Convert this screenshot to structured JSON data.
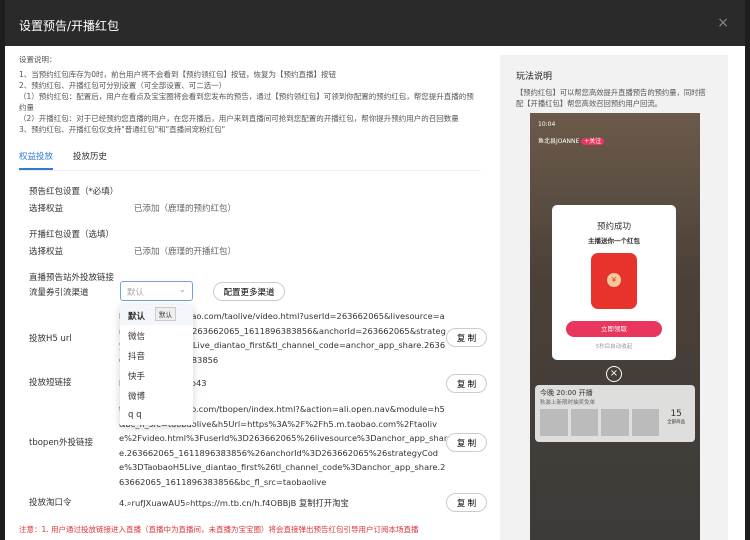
{
  "modal": {
    "title": "设置预告/开播红包",
    "close": "×"
  },
  "notes": {
    "title": "设置说明：",
    "lines": [
      "1、当预约红包库存为0时，前台用户将不会看到【预约领红包】按钮，恢复为【预约直播】按钮",
      "2、预约红包、开播红包可分别设置（可全部设置、可二选一）",
      "（1）预约红包：配置后，用户在看点及宝宝圈将会看到您发布的预告，通过【预约领红包】可领到你配置的预约红包，帮您提升直播的预约量",
      "（2）开播红包：对于已经预约您直播的用户，在您开播后，用户来到直播间可抢到您配置的开播红包，帮你提升预约用户的召回数量",
      "3、预约红包、开播红包仅支持\"普通红包\"和\"直播间宠粉红包\""
    ]
  },
  "tabs": [
    {
      "label": "权益投放",
      "active": true
    },
    {
      "label": "投放历史",
      "active": false
    }
  ],
  "preview_section": {
    "title": "预告红包设置（*必填）",
    "label": "选择权益",
    "value": "已添加（鹿瑾的预约红包）"
  },
  "live_section": {
    "title": "开播红包设置（选填）",
    "label": "选择权益",
    "value": "已添加（鹿瑾的开播红包）"
  },
  "links": {
    "title": "直播预告站外投放链接",
    "channel_label": "流量券引流渠道",
    "channel_placeholder": "默认",
    "more_channels": "配置更多渠道",
    "options": [
      "默认",
      "微信",
      "抖音",
      "快手",
      "微博",
      "q q"
    ],
    "tooltip": "默认",
    "rows": [
      {
        "label": "投放H5 url",
        "value": "https://h5.m.taobao.com/taolive/video.html?userId=263662065&livesource=anchor_app_share.263662065_1611896383856&anchorId=263662065&strategyCode=TaobaoH5Live_diantao_first&tl_channel_code=anchor_app_share.263662065_1611896383856",
        "copy": "复 制"
      },
      {
        "label": "投放短链接",
        "value": "https://m.tb.cn/.Vo43",
        "copy": "复 制"
      },
      {
        "label": "tbopen外投链接",
        "value": "tbopen://m.taobao.com/tbopen/index.html?&action=ali.open.nav&module=h5&bc_fl_src=taobaolive&h5Url=https%3A%2F%2Fh5.m.taobao.com%2Ftaolive%2Fvideo.html%3FuserId%3D263662065%26livesource%3Danchor_app_share.263662065_1611896383856%26anchorId%3D263662065%26strategyCode%3DTaobaoH5Live_diantao_first%26tl_channel_code%3Danchor_app_share.263662065_1611896383856&bc_fl_src=taobaolive",
        "copy": "复 制"
      },
      {
        "label": "投放淘口令",
        "value": "4.⌕rufJXuawAU5⌕https://m.tb.cn/h.f4OBBjB 复制打开淘宝",
        "copy": "复 制"
      }
    ],
    "warning": "注意：1. 用户通过投放链接进入直播（直播中为直播间，未直播为宝宝圈）将会直接弹出预告红包引导用户订阅本场直播"
  },
  "guide": {
    "title": "玩法说明",
    "desc": "【预约红包】可以帮您高效提升直播预告的预约量，同时搭配【开播红包】帮您高效召回预约用户回流。",
    "phone": {
      "time": "10:04",
      "anchor": "鱼北县JOANNE",
      "follow": "+关注",
      "popup_title": "预约成功",
      "popup_sub": "主播送你一个红包",
      "coin": "¥",
      "claim": "立即领取",
      "auto_close": "5秒后自动收起",
      "card_title": "今晚 20:00 开播",
      "card_sub": "秋装上新限时抽奖免单",
      "count": "15",
      "count_label": "全部商品"
    }
  }
}
